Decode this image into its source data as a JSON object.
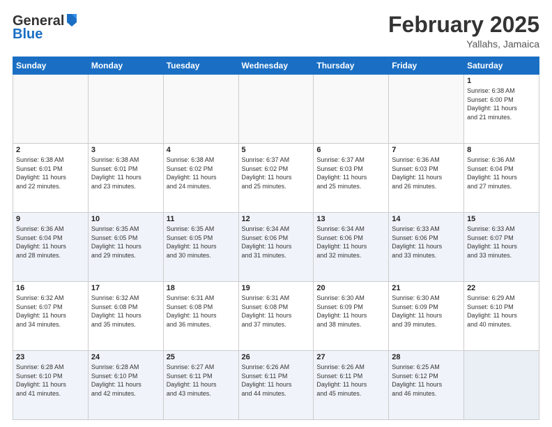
{
  "header": {
    "logo_general": "General",
    "logo_blue": "Blue",
    "month_title": "February 2025",
    "subtitle": "Yallahs, Jamaica"
  },
  "days_of_week": [
    "Sunday",
    "Monday",
    "Tuesday",
    "Wednesday",
    "Thursday",
    "Friday",
    "Saturday"
  ],
  "weeks": [
    {
      "alt": false,
      "days": [
        {
          "num": "",
          "info": ""
        },
        {
          "num": "",
          "info": ""
        },
        {
          "num": "",
          "info": ""
        },
        {
          "num": "",
          "info": ""
        },
        {
          "num": "",
          "info": ""
        },
        {
          "num": "",
          "info": ""
        },
        {
          "num": "1",
          "info": "Sunrise: 6:38 AM\nSunset: 6:00 PM\nDaylight: 11 hours\nand 21 minutes."
        }
      ]
    },
    {
      "alt": false,
      "days": [
        {
          "num": "2",
          "info": "Sunrise: 6:38 AM\nSunset: 6:01 PM\nDaylight: 11 hours\nand 22 minutes."
        },
        {
          "num": "3",
          "info": "Sunrise: 6:38 AM\nSunset: 6:01 PM\nDaylight: 11 hours\nand 23 minutes."
        },
        {
          "num": "4",
          "info": "Sunrise: 6:38 AM\nSunset: 6:02 PM\nDaylight: 11 hours\nand 24 minutes."
        },
        {
          "num": "5",
          "info": "Sunrise: 6:37 AM\nSunset: 6:02 PM\nDaylight: 11 hours\nand 25 minutes."
        },
        {
          "num": "6",
          "info": "Sunrise: 6:37 AM\nSunset: 6:03 PM\nDaylight: 11 hours\nand 25 minutes."
        },
        {
          "num": "7",
          "info": "Sunrise: 6:36 AM\nSunset: 6:03 PM\nDaylight: 11 hours\nand 26 minutes."
        },
        {
          "num": "8",
          "info": "Sunrise: 6:36 AM\nSunset: 6:04 PM\nDaylight: 11 hours\nand 27 minutes."
        }
      ]
    },
    {
      "alt": true,
      "days": [
        {
          "num": "9",
          "info": "Sunrise: 6:36 AM\nSunset: 6:04 PM\nDaylight: 11 hours\nand 28 minutes."
        },
        {
          "num": "10",
          "info": "Sunrise: 6:35 AM\nSunset: 6:05 PM\nDaylight: 11 hours\nand 29 minutes."
        },
        {
          "num": "11",
          "info": "Sunrise: 6:35 AM\nSunset: 6:05 PM\nDaylight: 11 hours\nand 30 minutes."
        },
        {
          "num": "12",
          "info": "Sunrise: 6:34 AM\nSunset: 6:06 PM\nDaylight: 11 hours\nand 31 minutes."
        },
        {
          "num": "13",
          "info": "Sunrise: 6:34 AM\nSunset: 6:06 PM\nDaylight: 11 hours\nand 32 minutes."
        },
        {
          "num": "14",
          "info": "Sunrise: 6:33 AM\nSunset: 6:06 PM\nDaylight: 11 hours\nand 33 minutes."
        },
        {
          "num": "15",
          "info": "Sunrise: 6:33 AM\nSunset: 6:07 PM\nDaylight: 11 hours\nand 33 minutes."
        }
      ]
    },
    {
      "alt": false,
      "days": [
        {
          "num": "16",
          "info": "Sunrise: 6:32 AM\nSunset: 6:07 PM\nDaylight: 11 hours\nand 34 minutes."
        },
        {
          "num": "17",
          "info": "Sunrise: 6:32 AM\nSunset: 6:08 PM\nDaylight: 11 hours\nand 35 minutes."
        },
        {
          "num": "18",
          "info": "Sunrise: 6:31 AM\nSunset: 6:08 PM\nDaylight: 11 hours\nand 36 minutes."
        },
        {
          "num": "19",
          "info": "Sunrise: 6:31 AM\nSunset: 6:08 PM\nDaylight: 11 hours\nand 37 minutes."
        },
        {
          "num": "20",
          "info": "Sunrise: 6:30 AM\nSunset: 6:09 PM\nDaylight: 11 hours\nand 38 minutes."
        },
        {
          "num": "21",
          "info": "Sunrise: 6:30 AM\nSunset: 6:09 PM\nDaylight: 11 hours\nand 39 minutes."
        },
        {
          "num": "22",
          "info": "Sunrise: 6:29 AM\nSunset: 6:10 PM\nDaylight: 11 hours\nand 40 minutes."
        }
      ]
    },
    {
      "alt": true,
      "days": [
        {
          "num": "23",
          "info": "Sunrise: 6:28 AM\nSunset: 6:10 PM\nDaylight: 11 hours\nand 41 minutes."
        },
        {
          "num": "24",
          "info": "Sunrise: 6:28 AM\nSunset: 6:10 PM\nDaylight: 11 hours\nand 42 minutes."
        },
        {
          "num": "25",
          "info": "Sunrise: 6:27 AM\nSunset: 6:11 PM\nDaylight: 11 hours\nand 43 minutes."
        },
        {
          "num": "26",
          "info": "Sunrise: 6:26 AM\nSunset: 6:11 PM\nDaylight: 11 hours\nand 44 minutes."
        },
        {
          "num": "27",
          "info": "Sunrise: 6:26 AM\nSunset: 6:11 PM\nDaylight: 11 hours\nand 45 minutes."
        },
        {
          "num": "28",
          "info": "Sunrise: 6:25 AM\nSunset: 6:12 PM\nDaylight: 11 hours\nand 46 minutes."
        },
        {
          "num": "",
          "info": ""
        }
      ]
    }
  ]
}
